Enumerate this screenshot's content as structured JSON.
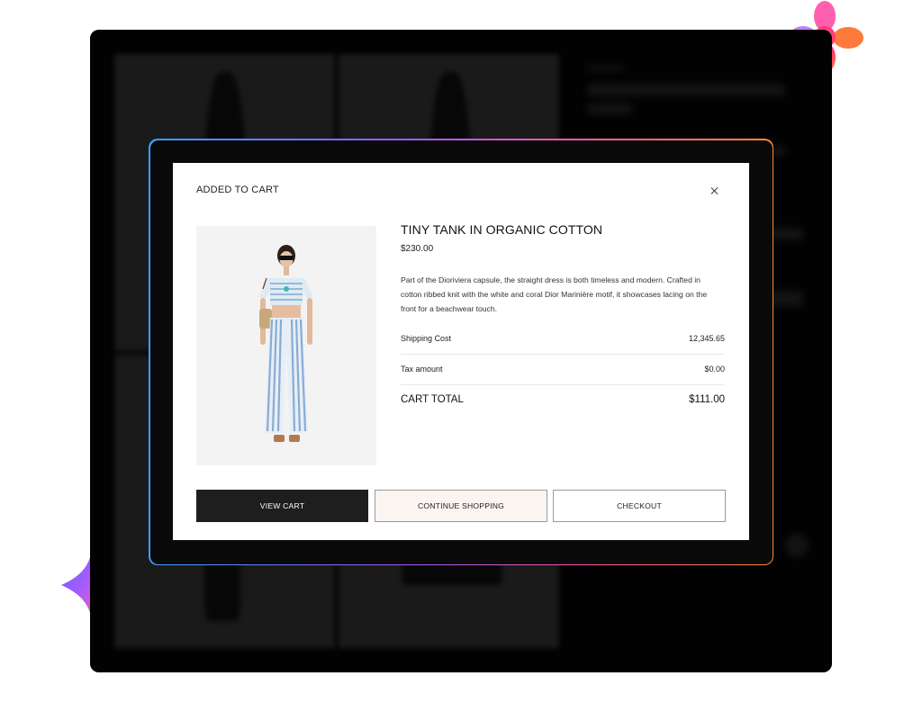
{
  "modal": {
    "title": "ADDED TO CART",
    "close_icon": "close-icon"
  },
  "product": {
    "name": "TINY TANK IN ORGANIC COTTON",
    "price": "$230.00",
    "description": "Part of the Dioriviera capsule, the straight dress is both timeless and modern. Crafted in cotton ribbed knit with the white and coral Dior Marinière motif, it showcases lacing on the front for a beachwear touch."
  },
  "summary": {
    "shipping_label": "Shipping Cost",
    "shipping_value": "12,345.65",
    "tax_label": "Tax amount",
    "tax_value": "$0.00",
    "total_label": "CART TOTAL",
    "total_value": "$111.00"
  },
  "buttons": {
    "view_cart": "VIEW CART",
    "continue_shopping": "CONTINUE SHOPPING",
    "checkout": "CHECKOUT"
  },
  "colors": {
    "primary_button": "#1e1e1e",
    "continue_button_bg": "#fbf5f2",
    "frame_gradient": [
      "#3aa0ff",
      "#9b5cff",
      "#ff5aa5",
      "#ff8a3a"
    ]
  }
}
